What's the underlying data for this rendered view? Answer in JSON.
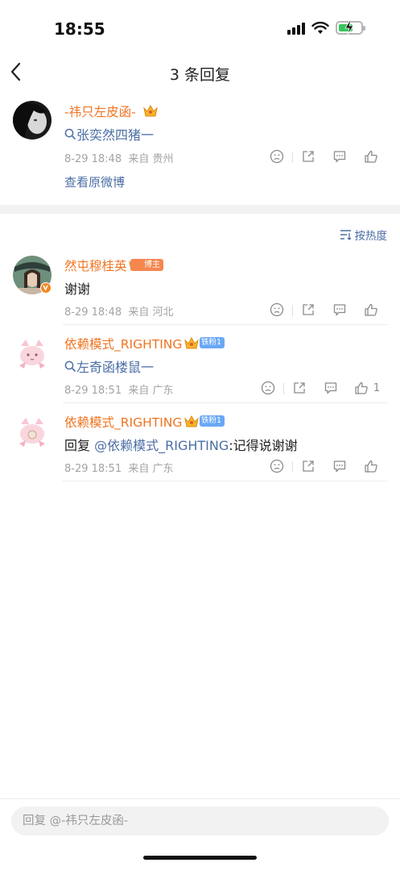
{
  "status_bar": {
    "time": "18:55"
  },
  "header": {
    "title": "3 条回复"
  },
  "original_comment": {
    "username": "-祎只左皮函-",
    "search_link": "张奕然四猪一",
    "date": "8-29 18:48",
    "location": "来自 贵州",
    "view_original": "查看原微博"
  },
  "sort": {
    "label": "按热度"
  },
  "replies": [
    {
      "username": "然屯穆桂英",
      "badge": "博主",
      "text": "谢谢",
      "date": "8-29 18:48",
      "location": "来自 河北",
      "like_count": ""
    },
    {
      "username": "依赖模式_RIGHTING",
      "badge": "铁粉1",
      "search_link": "左奇函楼鼠一",
      "date": "8-29 18:51",
      "location": "来自 广东",
      "like_count": "1"
    },
    {
      "username": "依赖模式_RIGHTING",
      "badge": "铁粉1",
      "reply_prefix": "回复",
      "mention": "@依赖模式_RIGHTING",
      "reply_text": ":记得说谢谢",
      "date": "8-29 18:51",
      "location": "来自 广东",
      "like_count": ""
    }
  ],
  "input": {
    "placeholder": "回复 @-祎只左皮函-"
  },
  "colors": {
    "username": "#ef7421",
    "link": "#4b6ea5",
    "meta": "#a3a3a3",
    "separator": "#f2f2f2"
  },
  "icons": [
    "back-chevron-icon",
    "search-icon",
    "dislike-face-icon",
    "share-icon",
    "comment-icon",
    "like-thumb-icon",
    "sort-icon",
    "crown-icon",
    "verified-badge-icon"
  ]
}
